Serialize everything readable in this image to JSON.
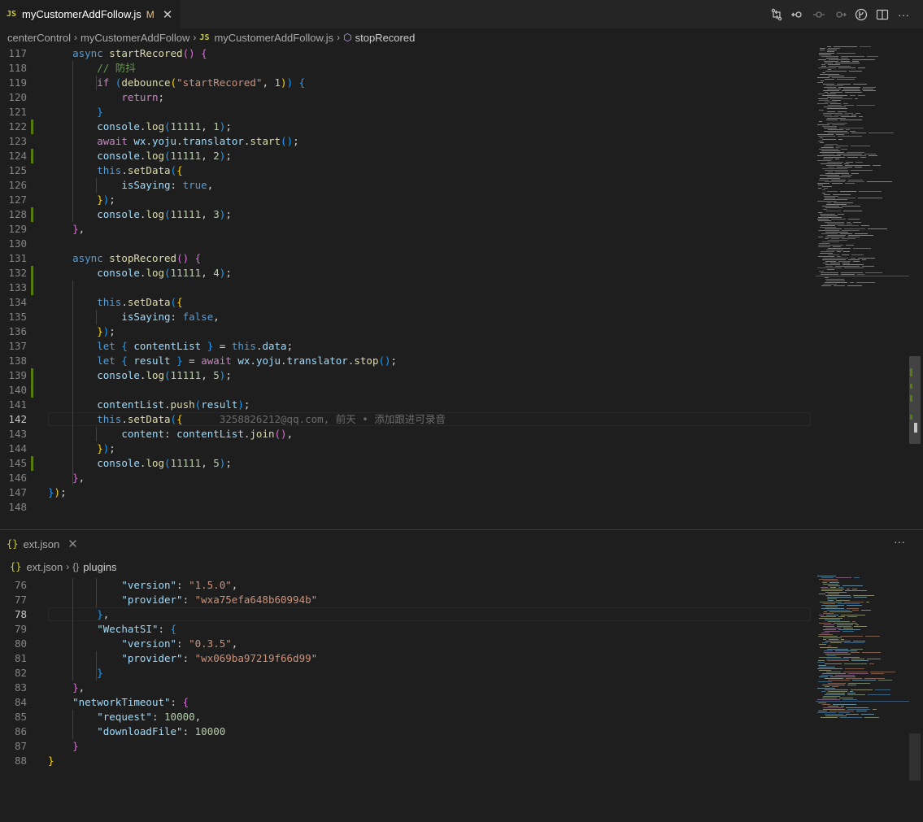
{
  "top_editor": {
    "tab": {
      "icon": "JS",
      "title": "myCustomerAddFollow.js",
      "modified": "M"
    },
    "breadcrumbs": [
      "centerControl",
      "myCustomerAddFollow",
      "myCustomerAddFollow.js",
      "stopRecored"
    ],
    "blame": "3258826212@qq.com, 前天 • 添加跟进可录音",
    "lines": [
      {
        "n": "117",
        "toks": [
          [
            "",
            "    "
          ],
          [
            "kw",
            "async "
          ],
          [
            "fn",
            "startRecored"
          ],
          [
            "p2",
            "()"
          ],
          [
            "",
            ""
          ],
          [
            "dim",
            " "
          ],
          [
            "p2",
            "{"
          ]
        ]
      },
      {
        "n": "118",
        "toks": [
          [
            "",
            "        "
          ],
          [
            "cm",
            "// 防抖"
          ]
        ]
      },
      {
        "n": "119",
        "toks": [
          [
            "",
            "        "
          ],
          [
            "ctl",
            "if "
          ],
          [
            "p3",
            "("
          ],
          [
            "fn",
            "debounce"
          ],
          [
            "p1",
            "("
          ],
          [
            "str",
            "\"startRecored\""
          ],
          [
            "dim",
            ", "
          ],
          [
            "num",
            "1"
          ],
          [
            "p1",
            ")"
          ],
          [
            "p3",
            ")"
          ],
          [
            "dim",
            " "
          ],
          [
            "p3",
            "{"
          ]
        ]
      },
      {
        "n": "120",
        "toks": [
          [
            "",
            "            "
          ],
          [
            "ctl",
            "return"
          ],
          [
            "dim",
            ";"
          ]
        ]
      },
      {
        "n": "121",
        "toks": [
          [
            "",
            "        "
          ],
          [
            "p3",
            "}"
          ]
        ]
      },
      {
        "n": "122",
        "toks": [
          [
            "",
            "        "
          ],
          [
            "vr",
            "console"
          ],
          [
            "dim",
            "."
          ],
          [
            "fn",
            "log"
          ],
          [
            "p3",
            "("
          ],
          [
            "num",
            "11111"
          ],
          [
            "dim",
            ", "
          ],
          [
            "num",
            "1"
          ],
          [
            "p3",
            ")"
          ],
          [
            "dim",
            ";"
          ]
        ]
      },
      {
        "n": "123",
        "toks": [
          [
            "",
            "        "
          ],
          [
            "ctl",
            "await "
          ],
          [
            "vr",
            "wx"
          ],
          [
            "dim",
            "."
          ],
          [
            "vr",
            "yoju"
          ],
          [
            "dim",
            "."
          ],
          [
            "vr",
            "translator"
          ],
          [
            "dim",
            "."
          ],
          [
            "fn",
            "start"
          ],
          [
            "p3",
            "()"
          ],
          [
            "dim",
            ";"
          ]
        ]
      },
      {
        "n": "124",
        "toks": [
          [
            "",
            "        "
          ],
          [
            "vr",
            "console"
          ],
          [
            "dim",
            "."
          ],
          [
            "fn",
            "log"
          ],
          [
            "p3",
            "("
          ],
          [
            "num",
            "11111"
          ],
          [
            "dim",
            ", "
          ],
          [
            "num",
            "2"
          ],
          [
            "p3",
            ")"
          ],
          [
            "dim",
            ";"
          ]
        ]
      },
      {
        "n": "125",
        "toks": [
          [
            "",
            "        "
          ],
          [
            "kw",
            "this"
          ],
          [
            "dim",
            "."
          ],
          [
            "fn",
            "setData"
          ],
          [
            "p3",
            "("
          ],
          [
            "p1",
            "{"
          ]
        ]
      },
      {
        "n": "126",
        "toks": [
          [
            "",
            "            "
          ],
          [
            "vr",
            "isSaying"
          ],
          [
            "dim",
            ": "
          ],
          [
            "kw",
            "true"
          ],
          [
            "dim",
            ","
          ]
        ]
      },
      {
        "n": "127",
        "toks": [
          [
            "",
            "        "
          ],
          [
            "p1",
            "}"
          ],
          [
            "p3",
            ")"
          ],
          [
            "dim",
            ";"
          ]
        ]
      },
      {
        "n": "128",
        "toks": [
          [
            "",
            "        "
          ],
          [
            "vr",
            "console"
          ],
          [
            "dim",
            "."
          ],
          [
            "fn",
            "log"
          ],
          [
            "p3",
            "("
          ],
          [
            "num",
            "11111"
          ],
          [
            "dim",
            ", "
          ],
          [
            "num",
            "3"
          ],
          [
            "p3",
            ")"
          ],
          [
            "dim",
            ";"
          ]
        ]
      },
      {
        "n": "129",
        "toks": [
          [
            "",
            "    "
          ],
          [
            "p2",
            "}"
          ],
          [
            "dim",
            ","
          ]
        ]
      },
      {
        "n": "130",
        "toks": []
      },
      {
        "n": "131",
        "toks": [
          [
            "",
            "    "
          ],
          [
            "kw",
            "async "
          ],
          [
            "fn",
            "stopRecored"
          ],
          [
            "p2",
            "()"
          ],
          [
            "dim",
            " "
          ],
          [
            "p2",
            "{"
          ]
        ]
      },
      {
        "n": "132",
        "toks": [
          [
            "",
            "        "
          ],
          [
            "vr",
            "console"
          ],
          [
            "dim",
            "."
          ],
          [
            "fn",
            "log"
          ],
          [
            "p3",
            "("
          ],
          [
            "num",
            "11111"
          ],
          [
            "dim",
            ", "
          ],
          [
            "num",
            "4"
          ],
          [
            "p3",
            ")"
          ],
          [
            "dim",
            ";"
          ]
        ]
      },
      {
        "n": "133",
        "toks": []
      },
      {
        "n": "134",
        "toks": [
          [
            "",
            "        "
          ],
          [
            "kw",
            "this"
          ],
          [
            "dim",
            "."
          ],
          [
            "fn",
            "setData"
          ],
          [
            "p3",
            "("
          ],
          [
            "p1",
            "{"
          ]
        ]
      },
      {
        "n": "135",
        "toks": [
          [
            "",
            "            "
          ],
          [
            "vr",
            "isSaying"
          ],
          [
            "dim",
            ": "
          ],
          [
            "kw",
            "false"
          ],
          [
            "dim",
            ","
          ]
        ]
      },
      {
        "n": "136",
        "toks": [
          [
            "",
            "        "
          ],
          [
            "p1",
            "}"
          ],
          [
            "p3",
            ")"
          ],
          [
            "dim",
            ";"
          ]
        ]
      },
      {
        "n": "137",
        "toks": [
          [
            "",
            "        "
          ],
          [
            "kw",
            "let "
          ],
          [
            "p3",
            "{ "
          ],
          [
            "vr",
            "contentList"
          ],
          [
            "p3",
            " }"
          ],
          [
            "dim",
            " = "
          ],
          [
            "kw",
            "this"
          ],
          [
            "dim",
            "."
          ],
          [
            "vr",
            "data"
          ],
          [
            "dim",
            ";"
          ]
        ]
      },
      {
        "n": "138",
        "toks": [
          [
            "",
            "        "
          ],
          [
            "kw",
            "let "
          ],
          [
            "p3",
            "{ "
          ],
          [
            "vr",
            "result"
          ],
          [
            "p3",
            " }"
          ],
          [
            "dim",
            " = "
          ],
          [
            "ctl",
            "await "
          ],
          [
            "vr",
            "wx"
          ],
          [
            "dim",
            "."
          ],
          [
            "vr",
            "yoju"
          ],
          [
            "dim",
            "."
          ],
          [
            "vr",
            "translator"
          ],
          [
            "dim",
            "."
          ],
          [
            "fn",
            "stop"
          ],
          [
            "p3",
            "()"
          ],
          [
            "dim",
            ";"
          ]
        ]
      },
      {
        "n": "139",
        "toks": [
          [
            "",
            "        "
          ],
          [
            "vr",
            "console"
          ],
          [
            "dim",
            "."
          ],
          [
            "fn",
            "log"
          ],
          [
            "p3",
            "("
          ],
          [
            "num",
            "11111"
          ],
          [
            "dim",
            ", "
          ],
          [
            "num",
            "5"
          ],
          [
            "p3",
            ")"
          ],
          [
            "dim",
            ";"
          ]
        ]
      },
      {
        "n": "140",
        "toks": []
      },
      {
        "n": "141",
        "toks": [
          [
            "",
            "        "
          ],
          [
            "vr",
            "contentList"
          ],
          [
            "dim",
            "."
          ],
          [
            "fn",
            "push"
          ],
          [
            "p3",
            "("
          ],
          [
            "vr",
            "result"
          ],
          [
            "p3",
            ")"
          ],
          [
            "dim",
            ";"
          ]
        ]
      },
      {
        "n": "142",
        "toks": [
          [
            "",
            "        "
          ],
          [
            "kw",
            "this"
          ],
          [
            "dim",
            "."
          ],
          [
            "fn",
            "setData"
          ],
          [
            "p3",
            "("
          ],
          [
            "p1",
            "{"
          ],
          [
            "",
            "      "
          ],
          [
            "blame",
            ""
          ]
        ]
      },
      {
        "n": "143",
        "toks": [
          [
            "",
            "            "
          ],
          [
            "vr",
            "content"
          ],
          [
            "dim",
            ": "
          ],
          [
            "vr",
            "contentList"
          ],
          [
            "dim",
            "."
          ],
          [
            "fn",
            "join"
          ],
          [
            "p2",
            "()"
          ],
          [
            "dim",
            ","
          ]
        ]
      },
      {
        "n": "144",
        "toks": [
          [
            "",
            "        "
          ],
          [
            "p1",
            "}"
          ],
          [
            "p3",
            ")"
          ],
          [
            "dim",
            ";"
          ]
        ]
      },
      {
        "n": "145",
        "toks": [
          [
            "",
            "        "
          ],
          [
            "vr",
            "console"
          ],
          [
            "dim",
            "."
          ],
          [
            "fn",
            "log"
          ],
          [
            "p3",
            "("
          ],
          [
            "num",
            "11111"
          ],
          [
            "dim",
            ", "
          ],
          [
            "num",
            "5"
          ],
          [
            "p3",
            ")"
          ],
          [
            "dim",
            ";"
          ]
        ]
      },
      {
        "n": "146",
        "toks": [
          [
            "",
            "    "
          ],
          [
            "p2",
            "}"
          ],
          [
            "dim",
            ","
          ]
        ]
      },
      {
        "n": "147",
        "toks": [
          [
            "p3",
            "}"
          ],
          [
            "p1",
            ")"
          ],
          [
            "dim",
            ";"
          ]
        ]
      },
      {
        "n": "148",
        "toks": []
      }
    ],
    "current_line": "142",
    "gutter_marks": [
      "122",
      "124",
      "128",
      "132",
      "133",
      "139",
      "140",
      "145"
    ]
  },
  "bottom_editor": {
    "tab": {
      "icon": "{}",
      "title": "ext.json"
    },
    "breadcrumbs": [
      "ext.json",
      "plugins"
    ],
    "more_label": "···",
    "lines": [
      {
        "n": "76",
        "toks": [
          [
            "",
            "            "
          ],
          [
            "vr",
            "\"version\""
          ],
          [
            "dim",
            ": "
          ],
          [
            "str",
            "\"1.5.0\""
          ],
          [
            "dim",
            ","
          ]
        ]
      },
      {
        "n": "77",
        "toks": [
          [
            "",
            "            "
          ],
          [
            "vr",
            "\"provider\""
          ],
          [
            "dim",
            ": "
          ],
          [
            "str",
            "\"wxa75efa648b60994b\""
          ]
        ]
      },
      {
        "n": "78",
        "toks": [
          [
            "",
            "        "
          ],
          [
            "p3",
            "}"
          ],
          [
            "dim",
            ","
          ]
        ]
      },
      {
        "n": "79",
        "toks": [
          [
            "",
            "        "
          ],
          [
            "vr",
            "\"WechatSI\""
          ],
          [
            "dim",
            ": "
          ],
          [
            "p3",
            "{"
          ]
        ]
      },
      {
        "n": "80",
        "toks": [
          [
            "",
            "            "
          ],
          [
            "vr",
            "\"version\""
          ],
          [
            "dim",
            ": "
          ],
          [
            "str",
            "\"0.3.5\""
          ],
          [
            "dim",
            ","
          ]
        ]
      },
      {
        "n": "81",
        "toks": [
          [
            "",
            "            "
          ],
          [
            "vr",
            "\"provider\""
          ],
          [
            "dim",
            ": "
          ],
          [
            "str",
            "\"wx069ba97219f66d99\""
          ]
        ]
      },
      {
        "n": "82",
        "toks": [
          [
            "",
            "        "
          ],
          [
            "p3",
            "}"
          ]
        ]
      },
      {
        "n": "83",
        "toks": [
          [
            "",
            "    "
          ],
          [
            "p2",
            "}"
          ],
          [
            "dim",
            ","
          ]
        ]
      },
      {
        "n": "84",
        "toks": [
          [
            "",
            "    "
          ],
          [
            "vr",
            "\"networkTimeout\""
          ],
          [
            "dim",
            ": "
          ],
          [
            "p2",
            "{"
          ]
        ]
      },
      {
        "n": "85",
        "toks": [
          [
            "",
            "        "
          ],
          [
            "vr",
            "\"request\""
          ],
          [
            "dim",
            ": "
          ],
          [
            "num",
            "10000"
          ],
          [
            "dim",
            ","
          ]
        ]
      },
      {
        "n": "86",
        "toks": [
          [
            "",
            "        "
          ],
          [
            "vr",
            "\"downloadFile\""
          ],
          [
            "dim",
            ": "
          ],
          [
            "num",
            "10000"
          ]
        ]
      },
      {
        "n": "87",
        "toks": [
          [
            "",
            "    "
          ],
          [
            "p2",
            "}"
          ]
        ]
      },
      {
        "n": "88",
        "toks": [
          [
            "p1",
            "}"
          ]
        ]
      }
    ],
    "current_line": "78"
  },
  "toolbar": {
    "icons": [
      "git-compare-icon",
      "go-back-icon",
      "dot-circle-icon",
      "go-forward-icon",
      "toggle-blame-icon",
      "split-editor-icon",
      "more-actions-icon"
    ],
    "more_label": "···"
  }
}
